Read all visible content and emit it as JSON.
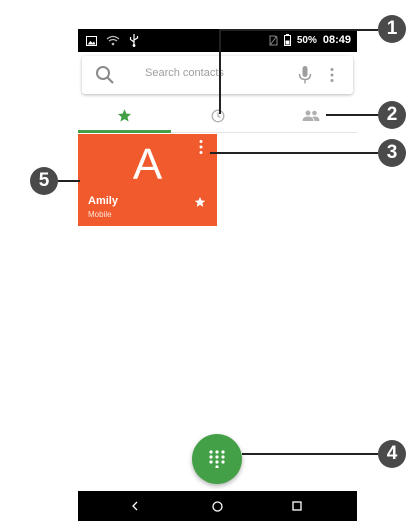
{
  "status_bar": {
    "battery": "50%",
    "time": "08:49",
    "icons": [
      "image-icon",
      "wifi-icon",
      "usb-icon",
      "no-sim-icon",
      "battery-icon"
    ]
  },
  "search": {
    "placeholder": "Search contacts",
    "icons": [
      "search-icon",
      "mic-icon",
      "more-vert-icon"
    ]
  },
  "tabs": [
    {
      "name": "favorites",
      "icon": "star-icon",
      "selected": true
    },
    {
      "name": "recents",
      "icon": "clock-icon",
      "selected": false
    },
    {
      "name": "contacts",
      "icon": "people-icon",
      "selected": false
    }
  ],
  "favorite_contact": {
    "initial": "A",
    "name": "Amily",
    "type": "Mobile",
    "color": "#f05a2c",
    "icons": [
      "more-vert-icon",
      "star-icon"
    ]
  },
  "fab": {
    "icon": "dialpad-icon",
    "color": "#43a047"
  },
  "navigation": [
    "back-icon",
    "home-icon",
    "recents-icon"
  ],
  "callouts": [
    "1",
    "2",
    "3",
    "4",
    "5"
  ],
  "colors": {
    "accent": "#43a047",
    "callout": "#4a4a4a"
  }
}
